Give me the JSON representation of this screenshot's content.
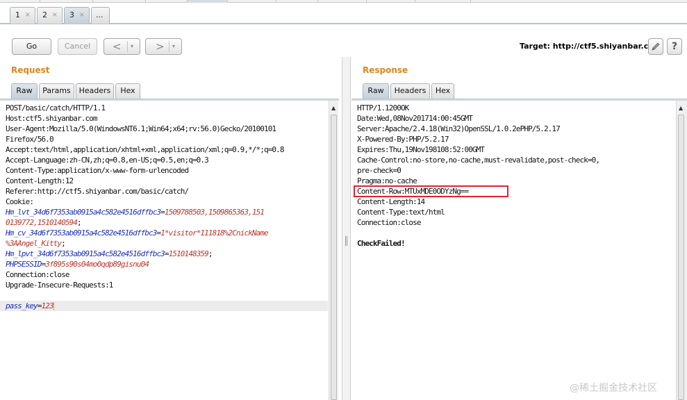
{
  "tabs": [
    {
      "label": "1",
      "close": "×"
    },
    {
      "label": "2",
      "close": "×"
    },
    {
      "label": "3",
      "close": "×"
    },
    {
      "label": "..."
    }
  ],
  "toolbar": {
    "go_label": "Go",
    "cancel_label": "Cancel",
    "back_glyph": "<",
    "forward_glyph": ">",
    "dropdown_glyph": "▾",
    "target_label": "Target: http://ctf5.shiyanbar.com",
    "help_glyph": "?"
  },
  "request": {
    "title": "Request",
    "tabs": [
      "Raw",
      "Params",
      "Headers",
      "Hex"
    ],
    "lines": [
      "POST/basic/catch/HTTP/1.1",
      "Host:ctf5.shiyanbar.com",
      "User-Agent:Mozilla/5.0(WindowsNT6.1;Win64;x64;rv:56.0)Gecko/20100101",
      "Firefox/56.0",
      "Accept:text/html,application/xhtml+xml,application/xml;q=0.9,*/*;q=0.8",
      "Accept-Language:zh-CN,zh;q=0.8,en-US;q=0.5,en;q=0.3",
      "Content-Type:application/x-www-form-urlencoded",
      "Content-Length:12",
      "Referer:http://ctf5.shiyanbar.com/basic/catch/",
      "Cookie:"
    ],
    "cookies": [
      {
        "key": "Hm_lvt_34d6f7353ab0915a4c582e4516dffbc3",
        "eq": "=",
        "value": "1509788503,1509865363,151",
        "value2": "0139772,1510140594",
        "sep": ";"
      },
      {
        "key": "Hm_cv_34d6f7353ab0915a4c582e4516dffbc3",
        "eq": "=",
        "value": "1*visitor*111818%2CnickName",
        "value2": "%3AAngel_Kitty",
        "sep": ";"
      },
      {
        "key": "Hm_lpvt_34d6f7353ab0915a4c582e4516dffbc3",
        "eq": "=",
        "value": "1510148359",
        "sep": ";"
      },
      {
        "key": "PHPSESSID",
        "eq": "=",
        "value": "3f895s90s04mo0qdp89gisnu04"
      }
    ],
    "tail_lines": [
      "Connection:close",
      "Upgrade-Insecure-Requests:1"
    ],
    "body": {
      "key": "pass_key",
      "eq": "=",
      "value": "123"
    }
  },
  "response": {
    "title": "Response",
    "tabs": [
      "Raw",
      "Headers",
      "Hex"
    ],
    "lines": [
      "HTTP/1.1200OK",
      "Date:Wed,08Nov201714:00:45GMT",
      "Server:Apache/2.4.18(Win32)OpenSSL/1.0.2ePHP/5.2.17",
      "X-Powered-By:PHP/5.2.17",
      "Expires:Thu,19Nov198108:52:00GMT",
      "Cache-Control:no-store,no-cache,must-revalidate,post-check=0,",
      "pre-check=0",
      "Pragma:no-cache",
      "Content-Row:MTUxMDE0ODYzNg==",
      "Content-Length:14",
      "Content-Type:text/html",
      "Connection:close"
    ],
    "body": "CheckFailed!"
  },
  "watermark": "@稀土掘金技术社区",
  "colors": {
    "accent": "#e0851e",
    "highlight_box": "#e0242b",
    "param_key": "#1a2ec0",
    "param_value": "#c0352a"
  }
}
